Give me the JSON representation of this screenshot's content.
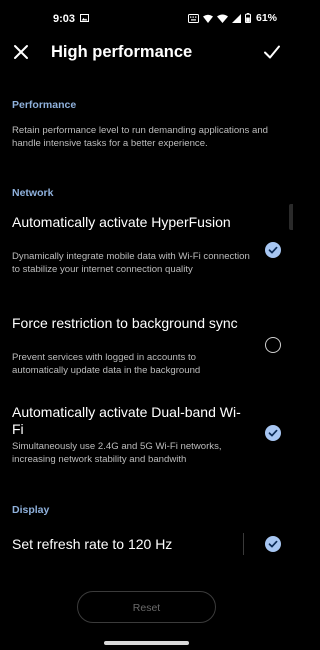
{
  "status_bar": {
    "time": "9:03",
    "battery": "61%",
    "icons": [
      "image-icon",
      "keyboard-icon",
      "signal-icon",
      "wifi-icon",
      "signal-bars-icon",
      "battery-icon"
    ]
  },
  "app_bar": {
    "title": "High performance"
  },
  "performance": {
    "header": "Performance",
    "description": "Retain performance level to run demanding applications and handle intensive tasks for a better experience."
  },
  "network": {
    "header": "Network",
    "items": [
      {
        "title": "Automatically activate HyperFusion",
        "description": "Dynamically integrate mobile data with Wi-Fi connection to stabilize your internet connection quality",
        "checked": true
      },
      {
        "title": "Force restriction to background sync",
        "description": "Prevent services with logged in accounts to automatically update data in the background",
        "checked": false
      },
      {
        "title": "Automatically activate Dual-band Wi-Fi",
        "description": "Simultaneously use 2.4G and 5G Wi-Fi networks, increasing network stability and bandwith",
        "checked": true
      }
    ]
  },
  "display": {
    "header": "Display",
    "items": [
      {
        "title": "Set refresh rate to 120 Hz",
        "checked": true
      }
    ]
  },
  "reset_label": "Reset",
  "colors": {
    "background": "#000000",
    "accent": "#a7c6f2",
    "section_header": "#8fb1dc",
    "secondary_text": "#bdbdbd"
  }
}
